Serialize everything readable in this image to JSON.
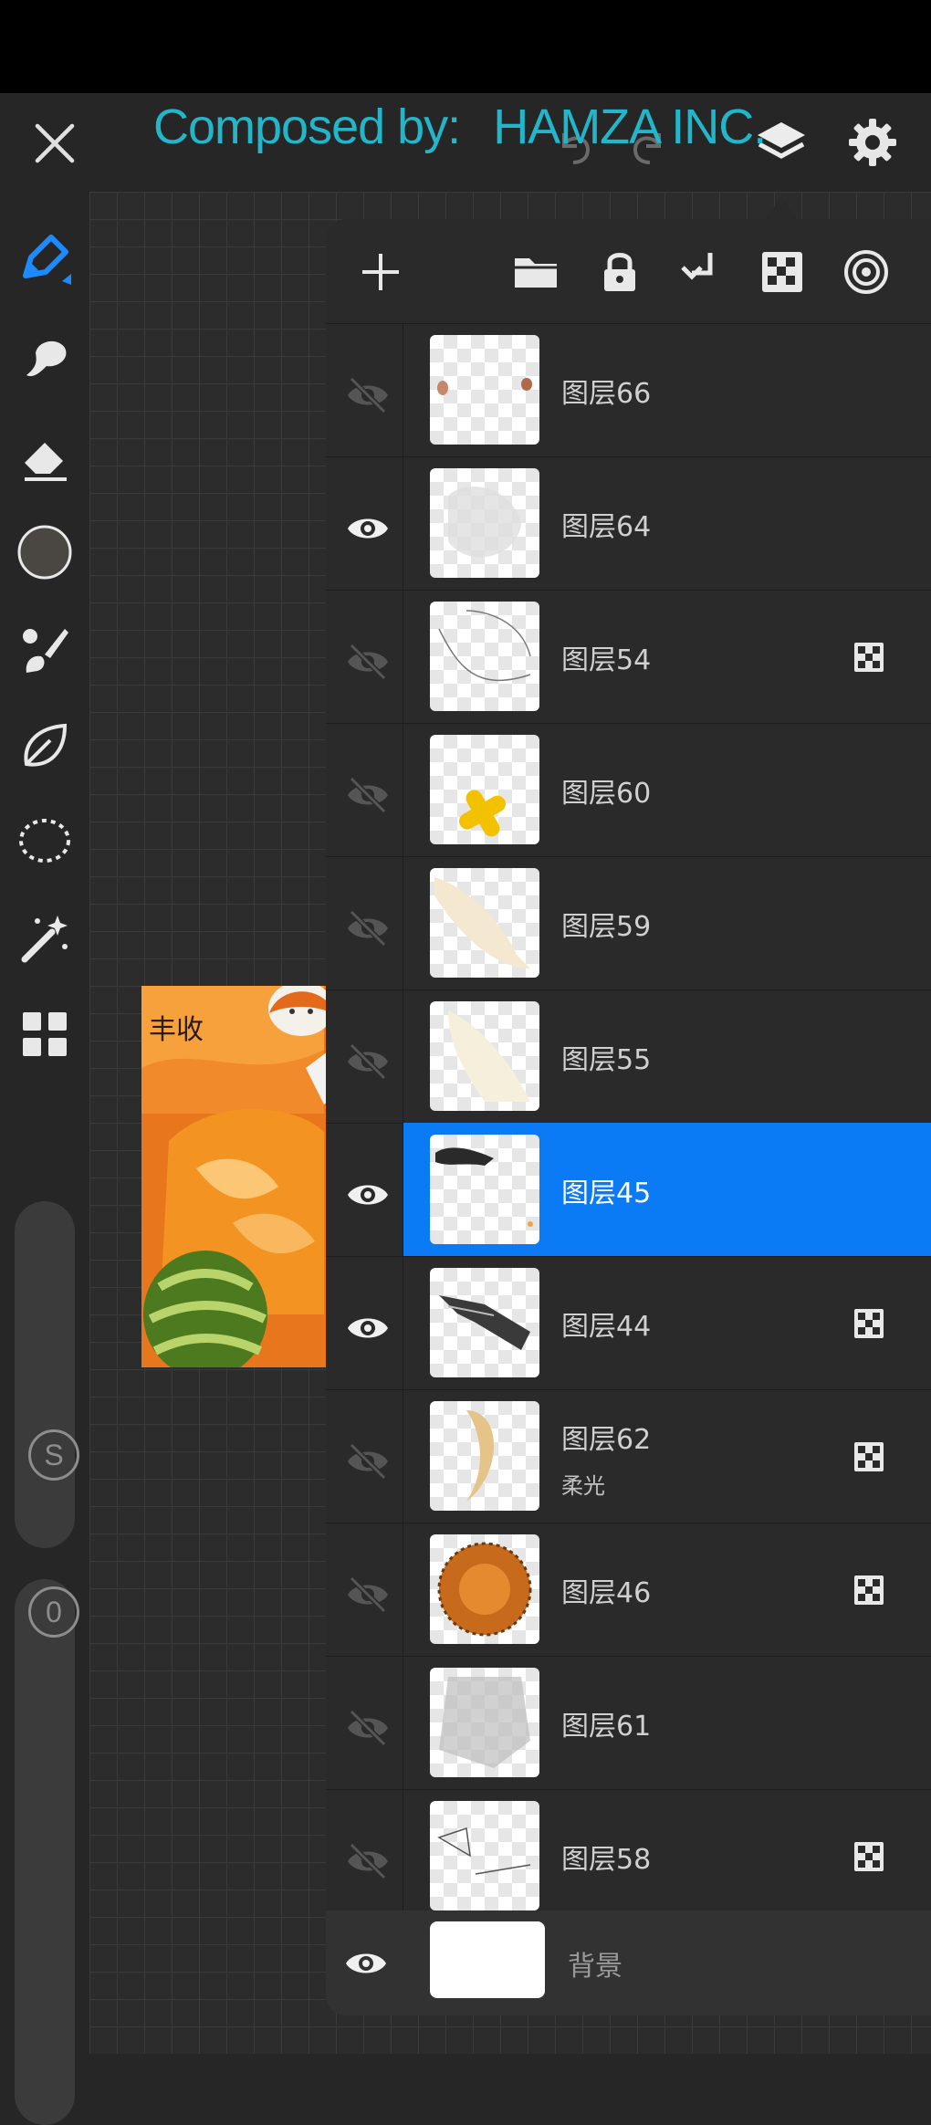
{
  "watermark": {
    "part1": "Composed by:",
    "part2": "HAMZA INC."
  },
  "toolbar": {
    "tools": [
      "pencil-icon",
      "smudge-icon",
      "eraser-icon",
      "color-picker-icon",
      "brush-icon",
      "shape-leaf-icon",
      "lasso-selection-icon",
      "magic-wand-icon",
      "gallery-grid-icon"
    ],
    "size_slider_label": "S",
    "opacity_slider_label": "0"
  },
  "top_actions": [
    "close-icon",
    "undo-icon",
    "redo-icon",
    "layers-icon",
    "settings-icon"
  ],
  "layers_panel": {
    "header_icons": [
      "add-icon",
      "folder-icon",
      "lock-icon",
      "merge-down-icon",
      "checkerboard-icon",
      "target-icon"
    ],
    "layers": [
      {
        "name": "图层66",
        "visible": false,
        "mask": false,
        "blend": ""
      },
      {
        "name": "图层64",
        "visible": true,
        "mask": false,
        "blend": ""
      },
      {
        "name": "图层54",
        "visible": false,
        "mask": true,
        "blend": ""
      },
      {
        "name": "图层60",
        "visible": false,
        "mask": false,
        "blend": ""
      },
      {
        "name": "图层59",
        "visible": false,
        "mask": false,
        "blend": ""
      },
      {
        "name": "图层55",
        "visible": false,
        "mask": false,
        "blend": ""
      },
      {
        "name": "图层45",
        "visible": true,
        "mask": false,
        "blend": "",
        "selected": true
      },
      {
        "name": "图层44",
        "visible": true,
        "mask": true,
        "blend": ""
      },
      {
        "name": "图层62",
        "visible": false,
        "mask": true,
        "blend": "柔光"
      },
      {
        "name": "图层46",
        "visible": false,
        "mask": true,
        "blend": ""
      },
      {
        "name": "图层61",
        "visible": false,
        "mask": false,
        "blend": ""
      },
      {
        "name": "图层58",
        "visible": false,
        "mask": true,
        "blend": ""
      }
    ],
    "background_layer": {
      "name": "背景",
      "visible": true
    }
  },
  "artwork": {
    "calligraphy": "丰收"
  }
}
